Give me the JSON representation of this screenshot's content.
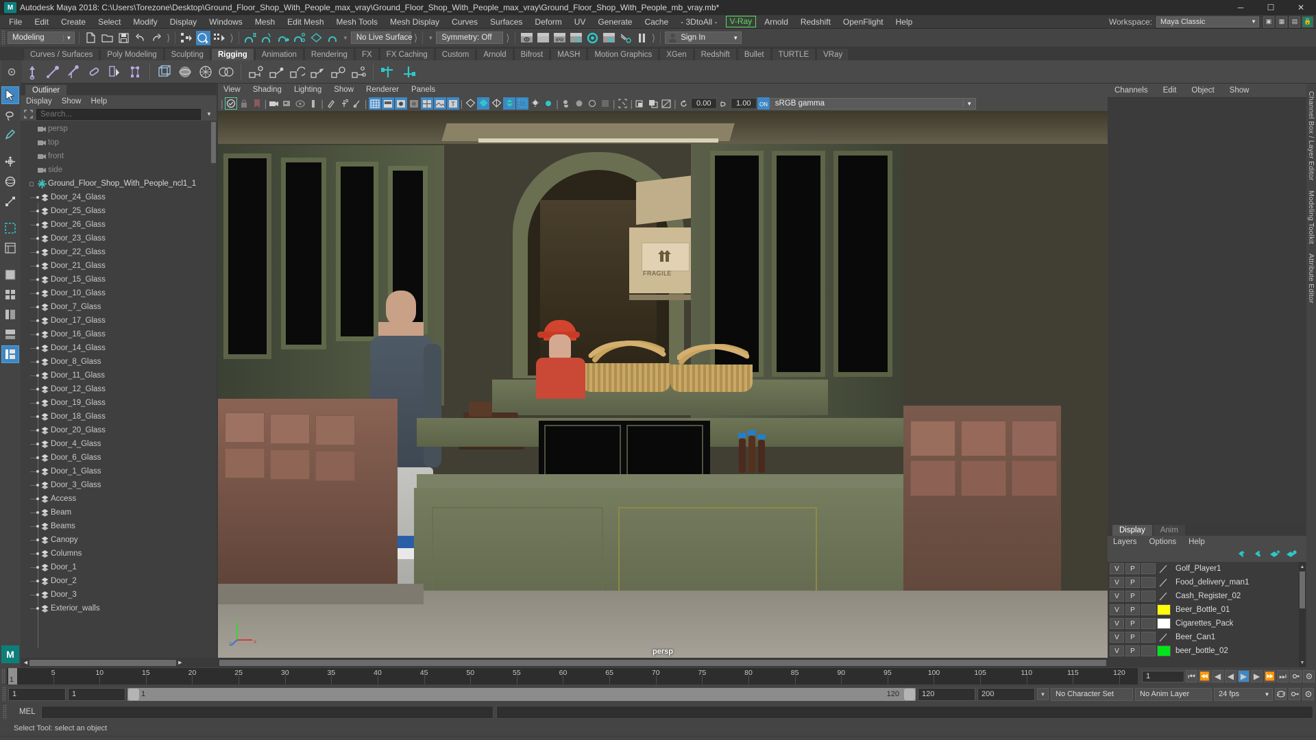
{
  "window": {
    "title": "Autodesk Maya 2018: C:\\Users\\Torezone\\Desktop\\Ground_Floor_Shop_With_People_max_vray\\Ground_Floor_Shop_With_People_max_vray\\Ground_Floor_Shop_With_People_mb_vray.mb*",
    "app_badge": "M",
    "minimize": "─",
    "maximize": "☐",
    "close": "✕"
  },
  "menubar": {
    "items": [
      "File",
      "Edit",
      "Create",
      "Select",
      "Modify",
      "Display",
      "Windows",
      "Mesh",
      "Edit Mesh",
      "Mesh Tools",
      "Mesh Display",
      "Curves",
      "Surfaces",
      "Deform",
      "UV",
      "Generate",
      "Cache",
      "- 3DtoAll -"
    ],
    "highlighted": "V-Ray",
    "items_after": [
      "Arnold",
      "Redshift",
      "OpenFlight",
      "Help"
    ],
    "workspace_label": "Workspace:",
    "workspace_value": "Maya Classic"
  },
  "statusbar": {
    "mode": "Modeling",
    "live_surface": "No Live Surface",
    "symmetry": "Symmetry: Off",
    "sign_in": "Sign In"
  },
  "shelf": {
    "tabs": [
      "Curves / Surfaces",
      "Poly Modeling",
      "Sculpting",
      "Rigging",
      "Animation",
      "Rendering",
      "FX",
      "FX Caching",
      "Custom",
      "Arnold",
      "Bifrost",
      "MASH",
      "Motion Graphics",
      "XGen",
      "Redshift",
      "Bullet",
      "TURTLE",
      "VRay"
    ],
    "active_tab": "Rigging"
  },
  "outliner": {
    "tab": "Outliner",
    "menu": [
      "Display",
      "Show",
      "Help"
    ],
    "search_placeholder": "Search...",
    "rows": [
      {
        "label": "persp",
        "type": "camera",
        "indent": 1
      },
      {
        "label": "top",
        "type": "camera",
        "indent": 1
      },
      {
        "label": "front",
        "type": "camera",
        "indent": 1
      },
      {
        "label": "side",
        "type": "camera",
        "indent": 1
      },
      {
        "label": "Ground_Floor_Shop_With_People_ncl1_1",
        "type": "root",
        "indent": 0
      },
      {
        "label": "Door_24_Glass",
        "type": "mesh",
        "indent": 1
      },
      {
        "label": "Door_25_Glass",
        "type": "mesh",
        "indent": 1
      },
      {
        "label": "Door_26_Glass",
        "type": "mesh",
        "indent": 1
      },
      {
        "label": "Door_23_Glass",
        "type": "mesh",
        "indent": 1
      },
      {
        "label": "Door_22_Glass",
        "type": "mesh",
        "indent": 1
      },
      {
        "label": "Door_21_Glass",
        "type": "mesh",
        "indent": 1
      },
      {
        "label": "Door_15_Glass",
        "type": "mesh",
        "indent": 1
      },
      {
        "label": "Door_10_Glass",
        "type": "mesh",
        "indent": 1
      },
      {
        "label": "Door_7_Glass",
        "type": "mesh",
        "indent": 1
      },
      {
        "label": "Door_17_Glass",
        "type": "mesh",
        "indent": 1
      },
      {
        "label": "Door_16_Glass",
        "type": "mesh",
        "indent": 1
      },
      {
        "label": "Door_14_Glass",
        "type": "mesh",
        "indent": 1
      },
      {
        "label": "Door_8_Glass",
        "type": "mesh",
        "indent": 1
      },
      {
        "label": "Door_11_Glass",
        "type": "mesh",
        "indent": 1
      },
      {
        "label": "Door_12_Glass",
        "type": "mesh",
        "indent": 1
      },
      {
        "label": "Door_19_Glass",
        "type": "mesh",
        "indent": 1
      },
      {
        "label": "Door_18_Glass",
        "type": "mesh",
        "indent": 1
      },
      {
        "label": "Door_20_Glass",
        "type": "mesh",
        "indent": 1
      },
      {
        "label": "Door_4_Glass",
        "type": "mesh",
        "indent": 1
      },
      {
        "label": "Door_6_Glass",
        "type": "mesh",
        "indent": 1
      },
      {
        "label": "Door_1_Glass",
        "type": "mesh",
        "indent": 1
      },
      {
        "label": "Door_3_Glass",
        "type": "mesh",
        "indent": 1
      },
      {
        "label": "Access",
        "type": "mesh",
        "indent": 1
      },
      {
        "label": "Beam",
        "type": "mesh",
        "indent": 1
      },
      {
        "label": "Beams",
        "type": "mesh",
        "indent": 1
      },
      {
        "label": "Canopy",
        "type": "mesh",
        "indent": 1
      },
      {
        "label": "Columns",
        "type": "mesh",
        "indent": 1
      },
      {
        "label": "Door_1",
        "type": "mesh",
        "indent": 1
      },
      {
        "label": "Door_2",
        "type": "mesh",
        "indent": 1
      },
      {
        "label": "Door_3",
        "type": "mesh",
        "indent": 1
      },
      {
        "label": "Exterior_walls",
        "type": "mesh",
        "indent": 1
      }
    ]
  },
  "viewport": {
    "menu": [
      "View",
      "Shading",
      "Lighting",
      "Show",
      "Renderer",
      "Panels"
    ],
    "exposure": "0.00",
    "gamma": "1.00",
    "color_space": "sRGB gamma",
    "camera_label": "persp",
    "axis": {
      "x": "x",
      "y": "y",
      "z": "z"
    },
    "box_label": "FRAGILE"
  },
  "channel_box": {
    "menu": [
      "Channels",
      "Edit",
      "Object",
      "Show"
    ]
  },
  "layers": {
    "tabs": [
      "Display",
      "Anim"
    ],
    "active_tab": "Display",
    "menu": [
      "Layers",
      "Options",
      "Help"
    ],
    "rows": [
      {
        "v": "V",
        "p": "P",
        "third": "",
        "color": "none",
        "name": "Golf_Player1"
      },
      {
        "v": "V",
        "p": "P",
        "third": "",
        "color": "none",
        "name": "Food_delivery_man1"
      },
      {
        "v": "V",
        "p": "P",
        "third": "",
        "color": "none",
        "name": "Cash_Register_02"
      },
      {
        "v": "V",
        "p": "P",
        "third": "",
        "color": "#ffff00",
        "name": "Beer_Bottle_01"
      },
      {
        "v": "V",
        "p": "P",
        "third": "",
        "color": "#ffffff",
        "name": "Cigarettes_Pack"
      },
      {
        "v": "V",
        "p": "P",
        "third": "",
        "color": "none",
        "name": "Beer_Can1"
      },
      {
        "v": "V",
        "p": "P",
        "third": "",
        "color": "#00e519",
        "name": "beer_bottle_02"
      }
    ]
  },
  "right_rail": {
    "labels": [
      "Channel Box / Layer Editor",
      "Modeling Toolkit",
      "Attribute Editor"
    ]
  },
  "timeline": {
    "current_frame": "1",
    "ticks": [
      5,
      10,
      15,
      20,
      25,
      30,
      35,
      40,
      45,
      50,
      55,
      60,
      65,
      70,
      75,
      80,
      85,
      90,
      95,
      100,
      105,
      110,
      115,
      120
    ],
    "field_frame": "1",
    "playback_start": "1",
    "range_start": "1",
    "range_end": "120",
    "anim_end": "120",
    "anim_max": "200",
    "character_set": "No Character Set",
    "anim_layer": "No Anim Layer",
    "fps": "24 fps"
  },
  "command_line": {
    "label": "MEL",
    "input": "",
    "output": ""
  },
  "status_text": "Select Tool: select an object",
  "colors": {
    "accent": "#3f87c4",
    "teal": "#2fb6b6",
    "vray_green": "#55e05a",
    "panel": "#444444",
    "dark": "#2b2b2b"
  }
}
